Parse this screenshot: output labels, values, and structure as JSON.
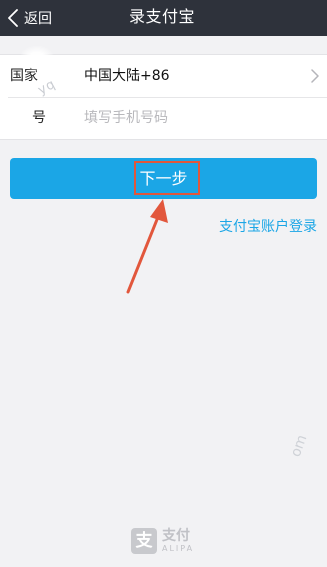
{
  "header": {
    "back_label": "返回",
    "title": "录支付宝"
  },
  "form": {
    "country": {
      "label": "国家",
      "value": "中国大陆+86"
    },
    "phone": {
      "label": "号",
      "placeholder": "填写手机号码",
      "value": ""
    }
  },
  "actions": {
    "next_label": "下一步",
    "account_login_label": "支付宝账户登录"
  },
  "footer": {
    "logo_glyph": "支",
    "logo_text": "支付",
    "logo_sub": "ALIPA"
  },
  "watermarks": {
    "top": "yq",
    "right": "om"
  },
  "colors": {
    "navbar": "#2e323b",
    "primary": "#1ba6e6",
    "annotation": "#e2573c",
    "background": "#f2f2f4"
  },
  "icons": {
    "back": "chevron-left-icon",
    "country_select": "chevron-right-icon",
    "annotation_arrow": "arrow-annotation-icon",
    "logo": "alipay-logo-icon"
  }
}
